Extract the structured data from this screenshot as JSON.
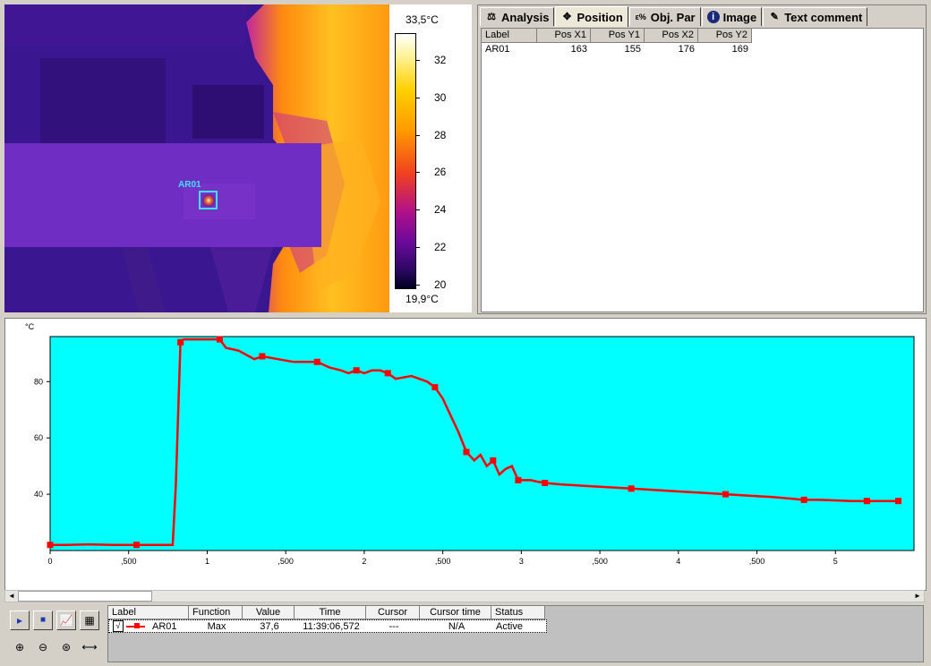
{
  "thermal": {
    "roi_label": "AR01",
    "colorbar": {
      "max_label": "33,5°C",
      "min_label": "19,9°C",
      "ticks": [
        "32",
        "30",
        "28",
        "26",
        "24",
        "22",
        "20"
      ]
    }
  },
  "tabs": [
    {
      "label": "Analysis",
      "icon": "analysis-icon"
    },
    {
      "label": "Position",
      "icon": "position-icon"
    },
    {
      "label": "Obj. Par",
      "icon": "object-parameters-icon"
    },
    {
      "label": "Image",
      "icon": "info-icon"
    },
    {
      "label": "Text comment",
      "icon": "text-comment-icon"
    }
  ],
  "active_tab": "Position",
  "position_table": {
    "columns": [
      "Label",
      "Pos X1",
      "Pos Y1",
      "Pos X2",
      "Pos Y2"
    ],
    "rows": [
      [
        "AR01",
        "163",
        "155",
        "176",
        "169"
      ]
    ]
  },
  "chart_data": {
    "type": "line",
    "ylabel": "°C",
    "xlabel": "",
    "xticks": [
      "0",
      ",500",
      "1",
      ",500",
      "2",
      ",500",
      "3",
      ",500",
      "4",
      ",500",
      "5"
    ],
    "yticks": [
      "40",
      "60",
      "80"
    ],
    "xlim": [
      0,
      5.5
    ],
    "ylim": [
      20,
      96
    ],
    "grid": false,
    "plot_bg": "#00ffff",
    "line_color": "#ff0000",
    "series": [
      {
        "name": "AR01",
        "x": [
          0,
          0.1,
          0.25,
          0.4,
          0.55,
          0.7,
          0.78,
          0.8,
          0.83,
          0.85,
          0.9,
          1.0,
          1.08,
          1.12,
          1.2,
          1.3,
          1.35,
          1.45,
          1.55,
          1.6,
          1.7,
          1.78,
          1.85,
          1.9,
          1.95,
          2.0,
          2.05,
          2.1,
          2.15,
          2.2,
          2.3,
          2.4,
          2.45,
          2.5,
          2.55,
          2.6,
          2.65,
          2.7,
          2.74,
          2.78,
          2.82,
          2.86,
          2.9,
          2.94,
          2.98,
          3.02,
          3.06,
          3.1,
          3.15,
          3.25,
          3.4,
          3.55,
          3.7,
          3.85,
          4.0,
          4.15,
          4.3,
          4.45,
          4.6,
          4.7,
          4.8,
          4.9,
          5.0,
          5.1,
          5.2,
          5.3,
          5.4
        ],
        "y": [
          22,
          22,
          22.2,
          22,
          22,
          22,
          22,
          43,
          94,
          95,
          95,
          95,
          95,
          92,
          91,
          88,
          89,
          88,
          87,
          87,
          87,
          85,
          84,
          83,
          84,
          83,
          84,
          84,
          83,
          81,
          82,
          80,
          78,
          74,
          68,
          62,
          55,
          52,
          54,
          50,
          52,
          47,
          49,
          50,
          45,
          45,
          45,
          44.5,
          44,
          43.5,
          43,
          42.5,
          42,
          41.5,
          41,
          40.5,
          40,
          39.5,
          39,
          38.5,
          38,
          38,
          37.8,
          37.6,
          37.6,
          37.6,
          37.6
        ]
      }
    ]
  },
  "legend_table": {
    "columns": [
      "Label",
      "Function",
      "Value",
      "Time",
      "Cursor",
      "Cursor time",
      "Status"
    ],
    "rows": [
      {
        "check": "√",
        "label": "AR01",
        "function": "Max",
        "value": "37,6",
        "time": "11:39:06,572",
        "cursor": "---",
        "cursor_time": "N/A",
        "status": "Active"
      }
    ]
  }
}
